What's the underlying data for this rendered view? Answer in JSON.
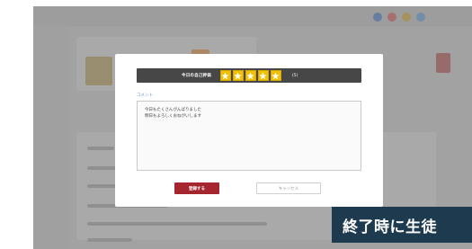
{
  "modal": {
    "header_title": "今日の自己評価",
    "rating": {
      "value": 5,
      "max": 5
    },
    "score_text": "(5)",
    "comment_label": "コメント",
    "comment_text": "今日もたくさんがんばりました\n明日もよろしくおねがいします",
    "register_button": "登録する",
    "cancel_button": "キャンセル"
  },
  "caption": {
    "text": "終了時に生徒"
  },
  "colors": {
    "header_bg": "#474747",
    "star": "#f2c200",
    "register_bg": "#a5262e",
    "caption_bg": "#1e3a4f",
    "comment_label": "#6b8fd6"
  }
}
